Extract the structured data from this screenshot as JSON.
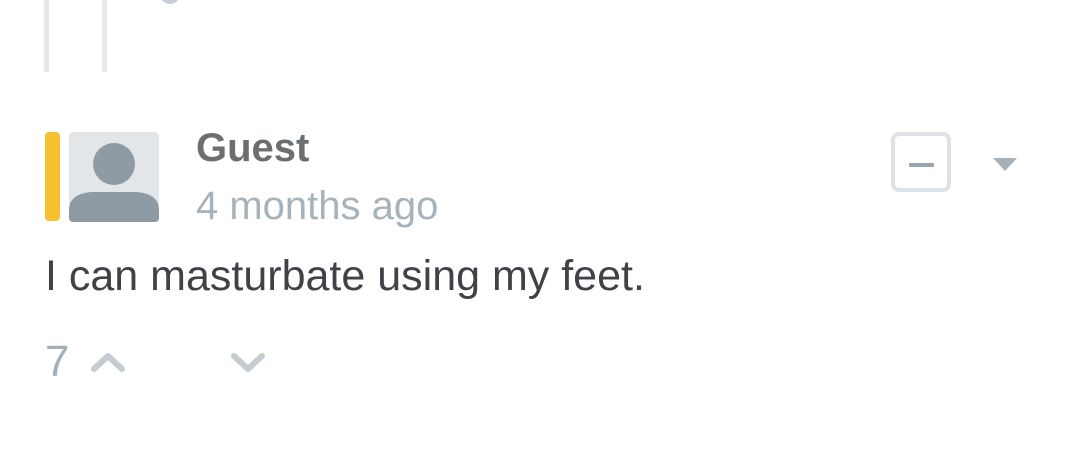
{
  "comment": {
    "author": "Guest",
    "timestamp": "4 months ago",
    "body": "I can masturbate using my feet.",
    "votes": "7",
    "accent_color": "#f5c02d"
  },
  "icons": {
    "avatar": "default-user-avatar-icon",
    "collapse": "minus-icon",
    "menu": "caret-down-icon",
    "upvote": "chevron-up-icon",
    "downvote": "chevron-down-icon"
  }
}
